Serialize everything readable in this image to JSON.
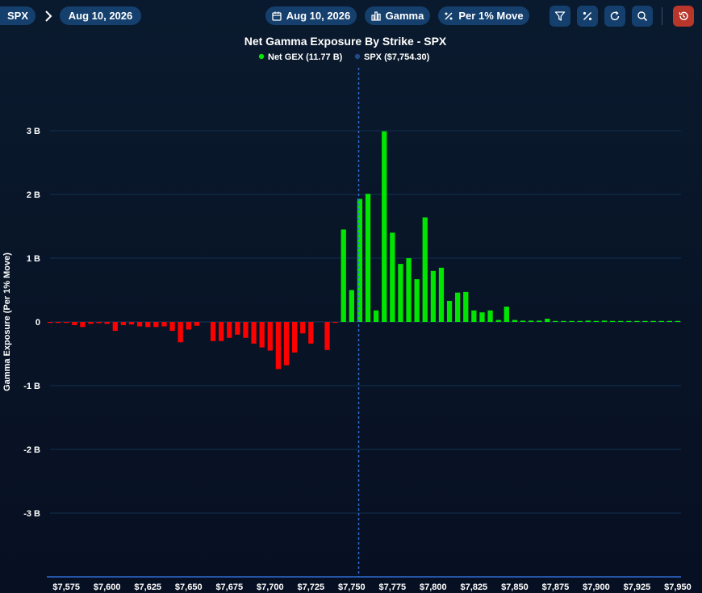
{
  "toolbar": {
    "symbol": "SPX",
    "expiration": "Aug 10, 2026",
    "date_selector": "Aug 10, 2026",
    "metric": "Gamma",
    "mode": "Per 1% Move"
  },
  "icons": {
    "calendar": "calendar-icon",
    "metric": "bar-chart-icon",
    "mode": "percent-icon",
    "filter": "filter-icon",
    "percent_toggle": "percent-icon",
    "refresh": "refresh-icon",
    "zoom": "zoom-icon",
    "reset": "history-reset-icon"
  },
  "colors": {
    "positive": "#00e600",
    "negative": "#ff0000",
    "spot_line": "#2f6bd1",
    "accent": "#15406e",
    "reset_button": "#b8362a"
  },
  "chart_data": {
    "type": "bar",
    "title": "Net Gamma Exposure By Strike - SPX",
    "ylabel": "Gamma Exposure (Per 1% Move)",
    "xlabel": "",
    "ylim": [
      -4.0,
      3.4
    ],
    "yticks": [
      3,
      2,
      1,
      0,
      -1,
      -2,
      -3
    ],
    "ytick_labels": [
      "3 B",
      "2 B",
      "1 B",
      "0",
      "-1 B",
      "-2 B",
      "-3 B"
    ],
    "xlim": [
      7565,
      7952
    ],
    "xticks": [
      7575,
      7600,
      7625,
      7650,
      7675,
      7700,
      7725,
      7750,
      7775,
      7800,
      7825,
      7850,
      7875,
      7900,
      7925,
      7950
    ],
    "xtick_labels": [
      "$7,575",
      "$7,600",
      "$7,625",
      "$7,650",
      "$7,675",
      "$7,700",
      "$7,725",
      "$7,750",
      "$7,775",
      "$7,800",
      "$7,825",
      "$7,850",
      "$7,875",
      "$7,900",
      "$7,925",
      "$7,950"
    ],
    "grid": true,
    "legend": [
      {
        "label": "Net GEX (11.77 B)",
        "color": "#00e600"
      },
      {
        "label": "SPX ($7,754.30)",
        "color": "#2f6bd1"
      }
    ],
    "spot": 7754.3,
    "strikes": [
      7565,
      7570,
      7575,
      7580,
      7585,
      7590,
      7595,
      7600,
      7605,
      7610,
      7615,
      7620,
      7625,
      7630,
      7635,
      7640,
      7645,
      7650,
      7655,
      7660,
      7665,
      7670,
      7675,
      7680,
      7685,
      7690,
      7695,
      7700,
      7705,
      7710,
      7715,
      7720,
      7725,
      7730,
      7735,
      7740,
      7745,
      7750,
      7755,
      7760,
      7765,
      7770,
      7775,
      7780,
      7785,
      7790,
      7795,
      7800,
      7805,
      7810,
      7815,
      7820,
      7825,
      7830,
      7835,
      7840,
      7845,
      7850,
      7855,
      7860,
      7865,
      7870,
      7875,
      7880,
      7885,
      7890,
      7895,
      7900,
      7905,
      7910,
      7915,
      7920,
      7925,
      7930,
      7935,
      7940,
      7945,
      7950
    ],
    "values": [
      -0.01,
      -0.01,
      -0.01,
      -0.05,
      -0.08,
      -0.03,
      -0.02,
      -0.03,
      -0.14,
      -0.05,
      -0.04,
      -0.07,
      -0.08,
      -0.08,
      -0.07,
      -0.14,
      -0.32,
      -0.12,
      -0.06,
      0,
      -0.3,
      -0.3,
      -0.25,
      -0.2,
      -0.25,
      -0.34,
      -0.4,
      -0.45,
      -0.74,
      -0.68,
      -0.48,
      -0.18,
      -0.34,
      0,
      -0.44,
      -0.01,
      1.45,
      0.5,
      1.93,
      2.01,
      0.18,
      2.99,
      1.4,
      0.91,
      1.0,
      0.67,
      1.64,
      0.8,
      0.85,
      0.33,
      0.46,
      0.47,
      0.18,
      0.15,
      0.18,
      0.03,
      0.24,
      0.03,
      0.02,
      0.02,
      0.02,
      0.05,
      0.01,
      0.01,
      0.01,
      0.01,
      0.02,
      0.01,
      0.02,
      0.01,
      0.01,
      0.01,
      0.01,
      0.01,
      0.01,
      0.01,
      0.01,
      0.01
    ]
  }
}
